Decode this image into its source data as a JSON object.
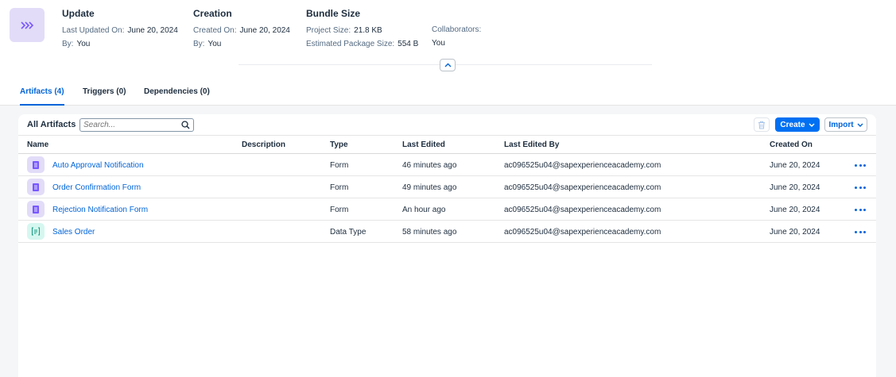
{
  "header": {
    "update": {
      "title": "Update",
      "last_updated_label": "Last Updated On:",
      "last_updated_value": "June 20, 2024",
      "by_label": "By:",
      "by_value": "You"
    },
    "creation": {
      "title": "Creation",
      "created_label": "Created On:",
      "created_value": "June 20, 2024",
      "by_label": "By:",
      "by_value": "You"
    },
    "bundle": {
      "title": "Bundle Size",
      "project_size_label": "Project Size:",
      "project_size_value": "21.8 KB",
      "package_size_label": "Estimated Package Size:",
      "package_size_value": "554 B"
    },
    "collaborators": {
      "label": "Collaborators:",
      "value": "You"
    }
  },
  "tabs": [
    {
      "label": "Artifacts (4)",
      "active": true
    },
    {
      "label": "Triggers (0)",
      "active": false
    },
    {
      "label": "Dependencies (0)",
      "active": false
    }
  ],
  "toolbar": {
    "title": "All Artifacts",
    "search_placeholder": "Search...",
    "create_label": "Create",
    "import_label": "Import"
  },
  "table": {
    "columns": [
      "Name",
      "Description",
      "Type",
      "Last Edited",
      "Last Edited By",
      "Created On"
    ],
    "rows": [
      {
        "icon": "form-icon",
        "name": "Auto Approval Notification",
        "description": "",
        "type": "Form",
        "last_edited": "46 minutes ago",
        "last_edited_by": "ac096525u04@sapexperienceacademy.com",
        "created_on": "June 20, 2024"
      },
      {
        "icon": "form-icon",
        "name": "Order Confirmation Form",
        "description": "",
        "type": "Form",
        "last_edited": "49 minutes ago",
        "last_edited_by": "ac096525u04@sapexperienceacademy.com",
        "created_on": "June 20, 2024"
      },
      {
        "icon": "form-icon",
        "name": "Rejection Notification Form",
        "description": "",
        "type": "Form",
        "last_edited": "An hour ago",
        "last_edited_by": "ac096525u04@sapexperienceacademy.com",
        "created_on": "June 20, 2024"
      },
      {
        "icon": "data-type-icon",
        "name": "Sales Order",
        "description": "",
        "type": "Data Type",
        "last_edited": "58 minutes ago",
        "last_edited_by": "ac096525u04@sapexperienceacademy.com",
        "created_on": "June 20, 2024"
      }
    ]
  },
  "colors": {
    "accent": "#0064d9",
    "primary_button": "#0070f2",
    "form_icon_bg": "#e2dcf8",
    "form_icon_fg": "#7858ff",
    "data_type_icon_bg": "#d5f7ef",
    "data_type_icon_fg": "#1e9e84"
  }
}
